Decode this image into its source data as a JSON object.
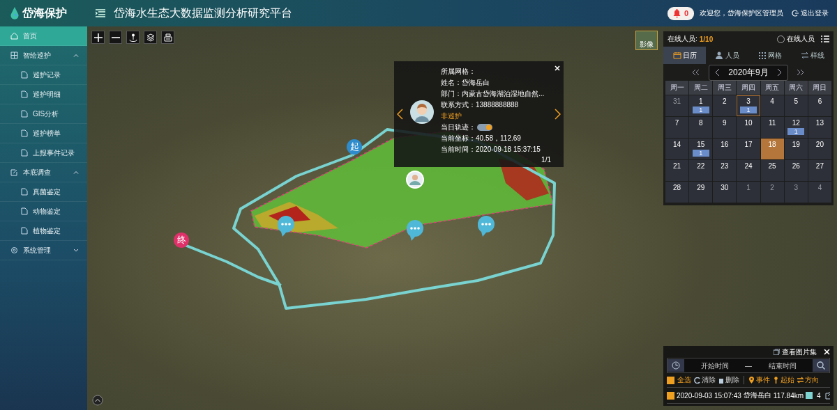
{
  "header": {
    "logo_text": "岱海保护",
    "title": "岱海水生态大数据监测分析研究平台",
    "alert_count": "0",
    "welcome": "欢迎您，岱海保护区管理员",
    "logout": "退出登录"
  },
  "sidebar": {
    "items": [
      {
        "label": "首页",
        "selected": true
      },
      {
        "label": "智绘巡护",
        "selected": false,
        "expanded": true,
        "children": [
          {
            "label": "巡护记录",
            "selected": false
          },
          {
            "label": "巡护明细",
            "selected": false
          },
          {
            "label": "GIS分析",
            "selected": false
          },
          {
            "label": "巡护榜单",
            "selected": false
          },
          {
            "label": "上报事件记录",
            "selected": false
          }
        ]
      },
      {
        "label": "本底调查",
        "selected": false,
        "expanded": true,
        "children": [
          {
            "label": "真菌鉴定",
            "selected": false
          },
          {
            "label": "动物鉴定",
            "selected": false
          },
          {
            "label": "植物鉴定",
            "selected": false
          }
        ]
      },
      {
        "label": "系统管理",
        "selected": false,
        "expanded": false
      }
    ]
  },
  "map": {
    "layer_switch": "影像",
    "markers": [
      {
        "kind": "start",
        "label": "起"
      },
      {
        "kind": "end",
        "label": "终"
      }
    ]
  },
  "popup": {
    "lines": [
      {
        "kind": "text",
        "text": "所属网格："
      },
      {
        "kind": "text",
        "text": "姓名：岱海岳白"
      },
      {
        "kind": "text",
        "text": "部门：内蒙古岱海湖泊湿地自然..."
      },
      {
        "kind": "text",
        "text": "联系方式：13888888888"
      },
      {
        "kind": "status",
        "text": "非巡护"
      },
      {
        "kind": "toggle",
        "text": "当日轨迹：",
        "on": true
      },
      {
        "kind": "text",
        "text": "当前坐标：40.58，112.69"
      },
      {
        "kind": "text",
        "text": "当前时间：2020-09-18 15:37:15"
      }
    ],
    "pager": "1/1"
  },
  "online_panel": {
    "title": "在线人员:",
    "count": "1/10",
    "filter": {
      "label": "在线人员",
      "checked": false
    },
    "tabs": [
      {
        "label": "日历",
        "selected": true
      },
      {
        "label": "人员",
        "selected": false
      },
      {
        "label": "网格",
        "selected": false
      },
      {
        "label": "样线",
        "selected": false
      }
    ],
    "calendar": {
      "month": "2020年9月",
      "weekdays": [
        "周一",
        "周二",
        "周三",
        "周四",
        "周五",
        "周六",
        "周日"
      ],
      "weeks": [
        [
          {
            "day": "31",
            "in_month": false,
            "selected": false,
            "focused": false
          },
          {
            "day": "1",
            "in_month": true,
            "selected": false,
            "focused": false,
            "count": "1"
          },
          {
            "day": "2",
            "in_month": true,
            "selected": false,
            "focused": false
          },
          {
            "day": "3",
            "in_month": true,
            "selected": false,
            "focused": true,
            "count": "1"
          },
          {
            "day": "4",
            "in_month": true,
            "selected": false,
            "focused": false
          },
          {
            "day": "5",
            "in_month": true,
            "selected": false,
            "focused": false
          },
          {
            "day": "6",
            "in_month": true,
            "selected": false,
            "focused": false
          }
        ],
        [
          {
            "day": "7",
            "in_month": true,
            "selected": false,
            "focused": false
          },
          {
            "day": "8",
            "in_month": true,
            "selected": false,
            "focused": false
          },
          {
            "day": "9",
            "in_month": true,
            "selected": false,
            "focused": false
          },
          {
            "day": "10",
            "in_month": true,
            "selected": false,
            "focused": false
          },
          {
            "day": "11",
            "in_month": true,
            "selected": false,
            "focused": false
          },
          {
            "day": "12",
            "in_month": true,
            "selected": false,
            "focused": false,
            "count": "1"
          },
          {
            "day": "13",
            "in_month": true,
            "selected": false,
            "focused": false
          }
        ],
        [
          {
            "day": "14",
            "in_month": true,
            "selected": false,
            "focused": false
          },
          {
            "day": "15",
            "in_month": true,
            "selected": false,
            "focused": false,
            "count": "1"
          },
          {
            "day": "16",
            "in_month": true,
            "selected": false,
            "focused": false
          },
          {
            "day": "17",
            "in_month": true,
            "selected": false,
            "focused": false
          },
          {
            "day": "18",
            "in_month": true,
            "selected": true,
            "focused": false
          },
          {
            "day": "19",
            "in_month": true,
            "selected": false,
            "focused": false
          },
          {
            "day": "20",
            "in_month": true,
            "selected": false,
            "focused": false
          }
        ],
        [
          {
            "day": "21",
            "in_month": true,
            "selected": false,
            "focused": false
          },
          {
            "day": "22",
            "in_month": true,
            "selected": false,
            "focused": false
          },
          {
            "day": "23",
            "in_month": true,
            "selected": false,
            "focused": false
          },
          {
            "day": "24",
            "in_month": true,
            "selected": false,
            "focused": false
          },
          {
            "day": "25",
            "in_month": true,
            "selected": false,
            "focused": false
          },
          {
            "day": "26",
            "in_month": true,
            "selected": false,
            "focused": false
          },
          {
            "day": "27",
            "in_month": true,
            "selected": false,
            "focused": false
          }
        ],
        [
          {
            "day": "28",
            "in_month": true,
            "selected": false,
            "focused": false
          },
          {
            "day": "29",
            "in_month": true,
            "selected": false,
            "focused": false
          },
          {
            "day": "30",
            "in_month": true,
            "selected": false,
            "focused": false
          },
          {
            "day": "1",
            "in_month": false,
            "selected": false,
            "focused": false
          },
          {
            "day": "2",
            "in_month": false,
            "selected": false,
            "focused": false
          },
          {
            "day": "3",
            "in_month": false,
            "selected": false,
            "focused": false
          },
          {
            "day": "4",
            "in_month": false,
            "selected": false,
            "focused": false
          }
        ]
      ]
    }
  },
  "track_panel": {
    "gallery_link": "查看图片集",
    "start_placeholder": "开始时间",
    "range_separator": "—",
    "end_placeholder": "结束时间",
    "select_all": {
      "label": "全选",
      "checked": true
    },
    "clear": "清除",
    "delete": "删除",
    "legend": [
      {
        "kind": "event",
        "label": "事件"
      },
      {
        "kind": "start",
        "label": "起始"
      },
      {
        "kind": "direction",
        "label": "方向"
      }
    ],
    "rows": [
      {
        "checked": true,
        "time": "2020-09-03 15:07:43",
        "name": "岱海岳白",
        "distance": "117.84km",
        "color": "#7fd3d0",
        "count": "4"
      }
    ]
  }
}
